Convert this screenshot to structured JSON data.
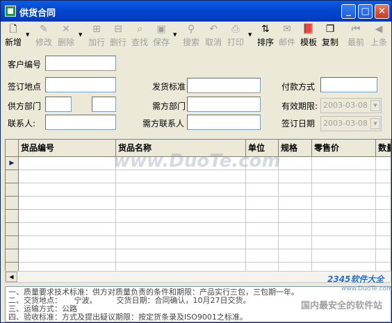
{
  "window": {
    "title": "供货合同",
    "btn_min": "_",
    "btn_max": "□",
    "btn_close": "✕"
  },
  "toolbar": {
    "items": [
      {
        "label": "新增",
        "icon": "new-doc-icon",
        "glyph": "🗋"
      },
      {
        "label": "修改",
        "icon": "edit-icon",
        "glyph": "✎"
      },
      {
        "label": "删除",
        "icon": "delete-icon",
        "glyph": "✕"
      },
      {
        "label": "加行",
        "icon": "add-row-icon",
        "glyph": "⊞"
      },
      {
        "label": "删行",
        "icon": "delete-row-icon",
        "glyph": "⊟"
      },
      {
        "label": "查找",
        "icon": "find-icon",
        "glyph": "⌕"
      },
      {
        "label": "保存",
        "icon": "save-icon",
        "glyph": "▣"
      },
      {
        "label": "搜索",
        "icon": "search-icon",
        "glyph": "⚲"
      },
      {
        "label": "取消",
        "icon": "undo-icon",
        "glyph": "↶"
      },
      {
        "label": "打印",
        "icon": "print-icon",
        "glyph": "⎙"
      },
      {
        "label": "排序",
        "icon": "sort-icon",
        "glyph": "⇅"
      },
      {
        "label": "邮件",
        "icon": "mail-icon",
        "glyph": "✉"
      },
      {
        "label": "模板",
        "icon": "template-icon",
        "glyph": "📕"
      },
      {
        "label": "复制",
        "icon": "copy-icon",
        "glyph": "❐"
      },
      {
        "label": "最前",
        "icon": "first-icon",
        "glyph": "⏮"
      },
      {
        "label": "上条",
        "icon": "prev-icon",
        "glyph": "◀"
      }
    ],
    "dropdown_arrow": "▼"
  },
  "form": {
    "customer_no_label": "客户编号",
    "sign_place_label": "签订地点",
    "supplier_dept_label": "供方部门",
    "contact_label": "联系人:",
    "ship_std_label": "发货标准",
    "buyer_dept_label": "需方部门",
    "buyer_contact_label": "需方联系人",
    "payment_label": "付款方式",
    "valid_label": "有效期限:",
    "valid_value": "2003-03-08",
    "sign_date_label": "签订日期",
    "sign_date_value": "2003-03-08",
    "dd_glyph": "▼"
  },
  "grid": {
    "columns": [
      "货品编号",
      "货品名称",
      "单位",
      "规格",
      "零售价",
      "数量"
    ],
    "current_row_glyph": "▶",
    "scroll_left": "◀",
    "scroll_right": "▶"
  },
  "notes": {
    "lines": [
      "一、质量要求技术标准：供方对质量负责的条件和期限：产品实行三包，三包期一年。",
      "二、交货地点：     宁波。        交货日期：合同确认，10月27日交货。",
      "三、运输方式：公路",
      "四、验收标准：方式及提出疑议期限：按定货条录及ISO9001之标准。"
    ]
  },
  "watermarks": {
    "duote": "www.DuoTe.com",
    "logo_2345": "2345软件大全",
    "logo_sub": "www.DuoTe.com",
    "slogan": "国内最安全的软件站"
  }
}
